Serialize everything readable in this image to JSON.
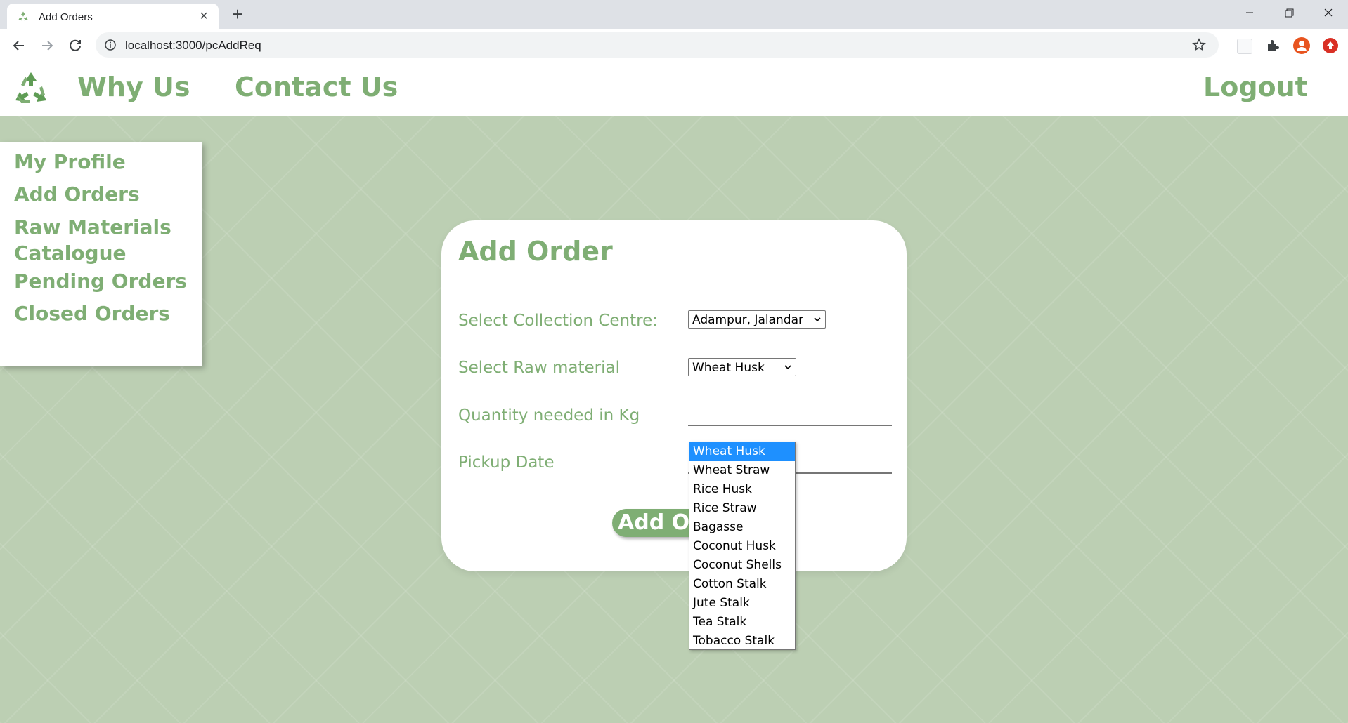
{
  "browser": {
    "tab_title": "Add Orders",
    "close_glyph": "×",
    "new_tab_glyph": "+",
    "url": "localhost:3000/pcAddReq",
    "accent_color": "#e8541f"
  },
  "header": {
    "logo": "recycle-logo",
    "nav": {
      "why_us": "Why Us",
      "contact_us": "Contact Us",
      "logout": "Logout"
    }
  },
  "sidebar": {
    "items": [
      {
        "label": "My Profile"
      },
      {
        "label": "Add Orders"
      },
      {
        "label": "Raw Materials Catalogue"
      },
      {
        "label": "Pending Orders"
      },
      {
        "label": "Closed Orders"
      }
    ]
  },
  "form": {
    "title": "Add Order",
    "collection_centre_label": "Select Collection Centre:",
    "collection_centre_value": "Adampur, Jalandar",
    "raw_material_label": "Select Raw material",
    "raw_material_value": "Wheat Husk",
    "quantity_label": "Quantity needed in Kg",
    "pickup_date_label": "Pickup Date",
    "submit_label": "Add Order"
  },
  "raw_material_options": [
    "Wheat Husk",
    "Wheat Straw",
    "Rice Husk",
    "Rice Straw",
    "Bagasse",
    "Coconut Husk",
    "Coconut Shells",
    "Cotton Stalk",
    "Jute Stalk",
    "Tea Stalk",
    "Tobacco Stalk"
  ],
  "raw_material_selected_index": 0,
  "colors": {
    "brand_green": "#7fae74",
    "background": "#bccfb3",
    "highlight": "#1e90ff"
  }
}
